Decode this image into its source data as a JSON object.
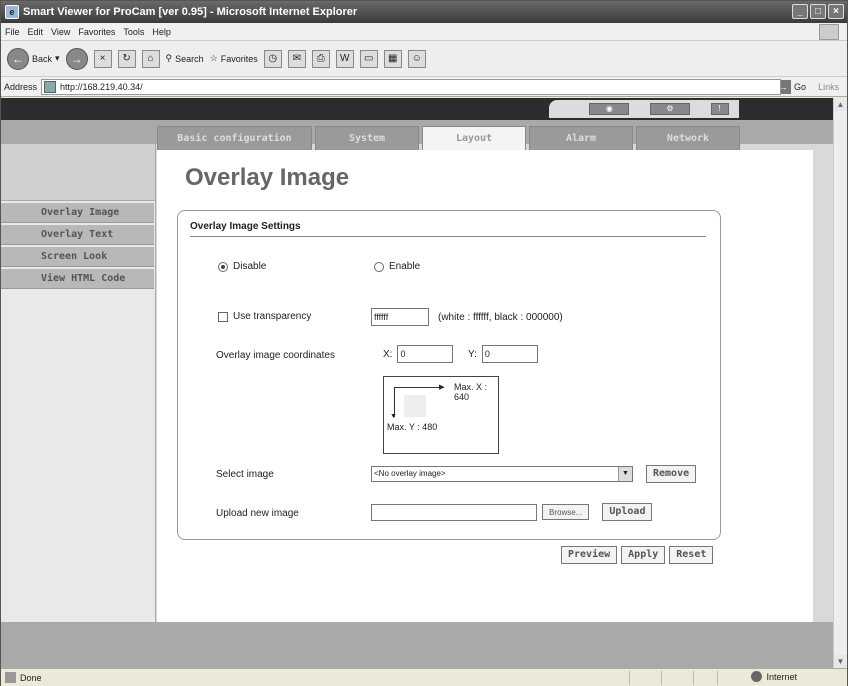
{
  "window": {
    "title": "Smart Viewer for ProCam [ver 0.95] - Microsoft Internet Explorer"
  },
  "menu": [
    "File",
    "Edit",
    "View",
    "Favorites",
    "Tools",
    "Help"
  ],
  "toolbar": {
    "back": "Back",
    "search": "Search",
    "favorites": "Favorites"
  },
  "address": {
    "label": "Address",
    "url": "http://168.219.40.34/",
    "go": "Go",
    "links": "Links"
  },
  "tabs": [
    "Basic configuration",
    "System",
    "Layout",
    "Alarm",
    "Network"
  ],
  "active_tab": "Layout",
  "sidebar": [
    "Overlay Image",
    "Overlay Text",
    "Screen Look",
    "View HTML Code"
  ],
  "page": {
    "title": "Overlay Image",
    "section_title": "Overlay Image Settings",
    "disable_label": "Disable",
    "enable_label": "Enable",
    "transparency_label": "Use transparency",
    "transparency_value": "ffffff",
    "transparency_hint": "(white : ffffff, black : 000000)",
    "coords_label": "Overlay image coordinates",
    "x_label": "X:",
    "x_value": "0",
    "y_label": "Y:",
    "y_value": "0",
    "max_x": "Max. X : 640",
    "max_y": "Max. Y : 480",
    "select_label": "Select image",
    "select_value": "<No overlay image>",
    "remove_label": "Remove",
    "upload_label": "Upload new image",
    "browse_label": "Browse...",
    "upload_button": "Upload",
    "preview": "Preview",
    "apply": "Apply",
    "reset": "Reset"
  },
  "status": {
    "left": "Done",
    "zone": "Internet"
  }
}
